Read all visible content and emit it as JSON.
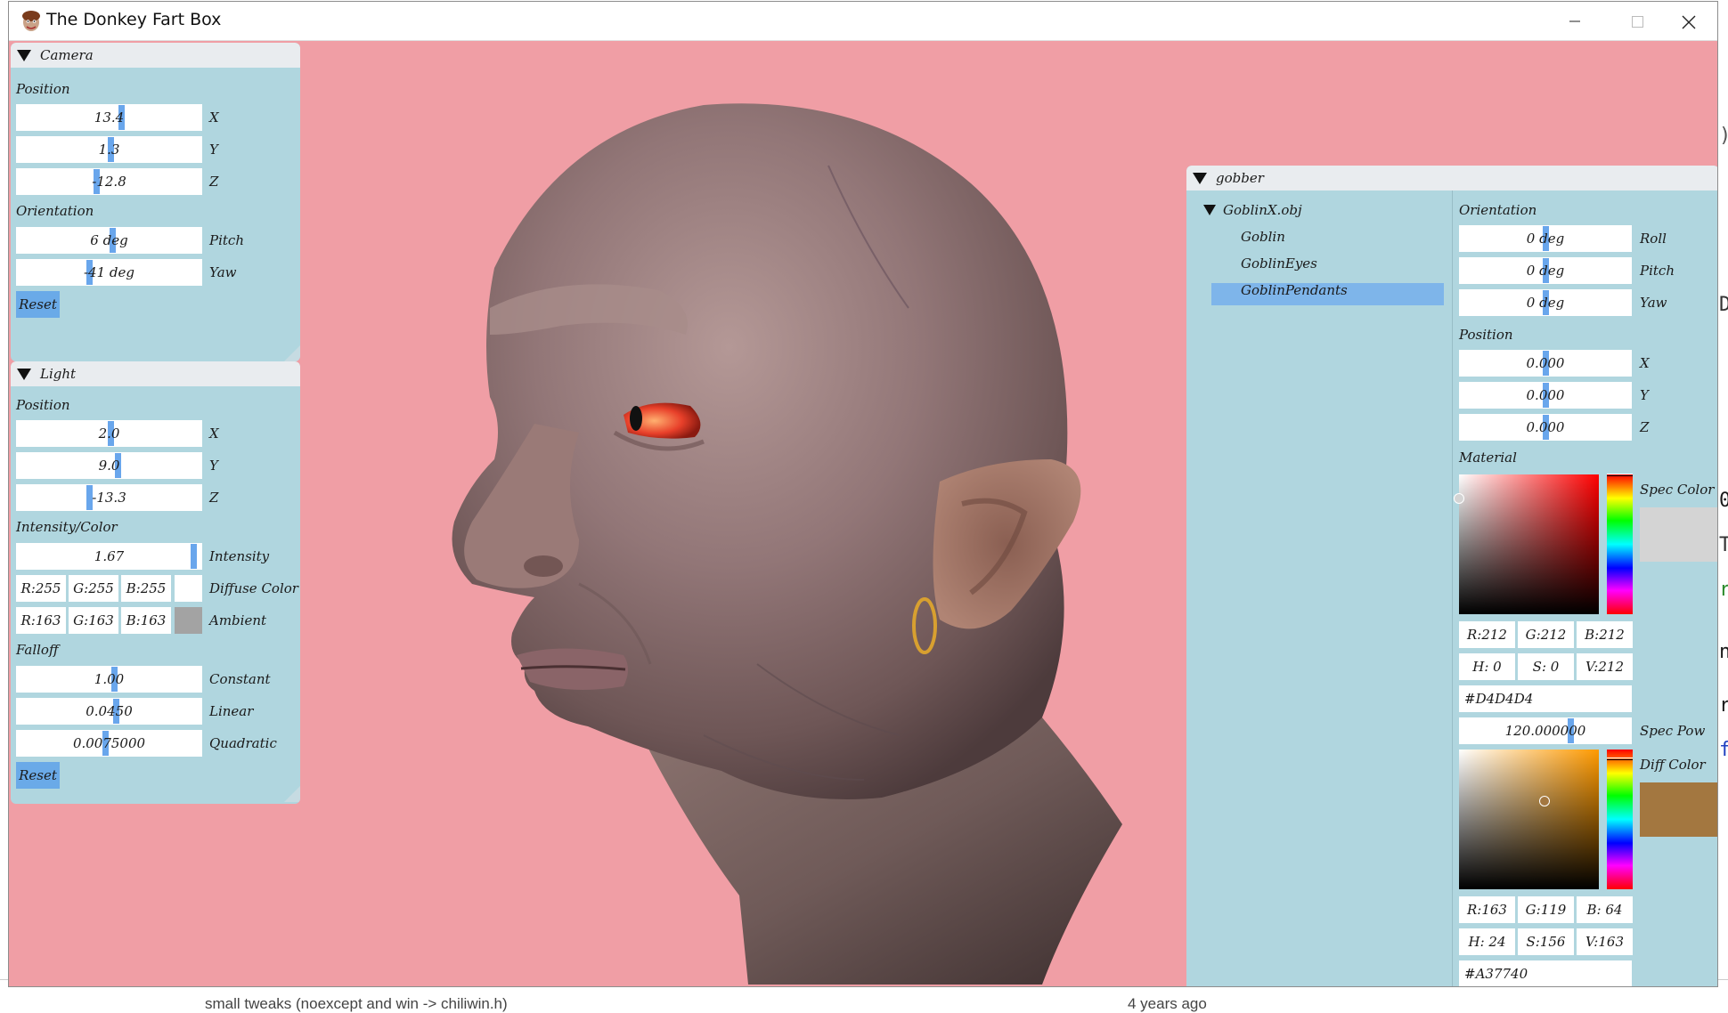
{
  "window": {
    "title": "The Donkey Fart Box",
    "background": "#f09ea5"
  },
  "background_app": {
    "commit_message": "small tweaks (noexcept and win -> chiliwin.h)",
    "age": "4 years ago"
  },
  "camera": {
    "title": "Camera",
    "position_label": "Position",
    "position": [
      {
        "value": "13.4",
        "axis": "X",
        "frac": 0.57
      },
      {
        "value": "1.3",
        "axis": "Y",
        "frac": 0.51
      },
      {
        "value": "-12.8",
        "axis": "Z",
        "frac": 0.43
      }
    ],
    "orientation_label": "Orientation",
    "orientation": [
      {
        "value": "6 deg",
        "axis": "Pitch",
        "frac": 0.52
      },
      {
        "value": "-41 deg",
        "axis": "Yaw",
        "frac": 0.39
      }
    ],
    "reset_label": "Reset"
  },
  "light": {
    "title": "Light",
    "position_label": "Position",
    "position": [
      {
        "value": "2.0",
        "axis": "X",
        "frac": 0.51
      },
      {
        "value": "9.0",
        "axis": "Y",
        "frac": 0.55
      },
      {
        "value": "-13.3",
        "axis": "Z",
        "frac": 0.39
      }
    ],
    "intensity_color_label": "Intensity/Color",
    "intensity": {
      "value": "1.67",
      "label": "Intensity",
      "frac": 0.97
    },
    "diffuse": {
      "r": "R:255",
      "g": "G:255",
      "b": "B:255",
      "label": "Diffuse Color",
      "color": "#ffffff"
    },
    "ambient": {
      "r": "R:163",
      "g": "G:163",
      "b": "B:163",
      "label": "Ambient",
      "color": "#a3a3a3"
    },
    "falloff_label": "Falloff",
    "falloff": [
      {
        "value": "1.00",
        "label": "Constant",
        "frac": 0.53
      },
      {
        "value": "0.0450",
        "label": "Linear",
        "frac": 0.54
      },
      {
        "value": "0.0075000",
        "label": "Quadratic",
        "frac": 0.48
      }
    ],
    "reset_label": "Reset"
  },
  "gobber": {
    "title": "gobber",
    "tree": {
      "root": "GoblinX.obj",
      "children": [
        "Goblin",
        "GoblinEyes",
        "GoblinPendants"
      ],
      "selected": "GoblinPendants"
    },
    "orientation_label": "Orientation",
    "orientation": [
      {
        "value": "0 deg",
        "axis": "Roll",
        "frac": 0.5
      },
      {
        "value": "0 deg",
        "axis": "Pitch",
        "frac": 0.5
      },
      {
        "value": "0 deg",
        "axis": "Yaw",
        "frac": 0.5
      }
    ],
    "position_label": "Position",
    "position": [
      {
        "value": "0.000",
        "axis": "X",
        "frac": 0.5
      },
      {
        "value": "0.000",
        "axis": "Y",
        "frac": 0.5
      },
      {
        "value": "0.000",
        "axis": "Z",
        "frac": 0.5
      }
    ],
    "material_label": "Material",
    "spec": {
      "label": "Spec Color",
      "color": "#d4d4d4",
      "hue_color": "#ff0000",
      "r": "R:212",
      "g": "G:212",
      "b": "B:212",
      "h": "H: 0",
      "s": "S: 0",
      "v": "V:212",
      "hex": "#D4D4D4"
    },
    "spec_pow": {
      "value": "120.000000",
      "label": "Spec Pow",
      "frac": 0.65
    },
    "diff": {
      "label": "Diff Color",
      "color": "#a37740",
      "hue_color": "#ff9a00",
      "r": "R:163",
      "g": "G:119",
      "b": "B: 64",
      "h": "H: 24",
      "s": "S:156",
      "v": "V:163",
      "hex": "#A37740"
    }
  }
}
